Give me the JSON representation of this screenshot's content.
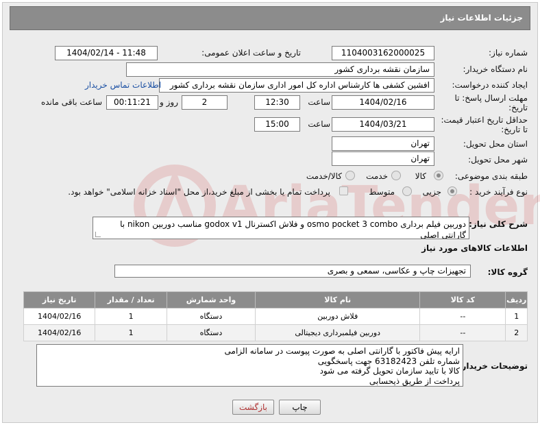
{
  "header": {
    "title": "جزئیات اطلاعات نیاز"
  },
  "watermark": {
    "text": "AriaTender.net"
  },
  "form": {
    "need_number": {
      "label": "شماره نیاز:",
      "value": "1104003162000025"
    },
    "announce_datetime": {
      "label": "تاریخ و ساعت اعلان عمومی:",
      "value": "1404/02/14 - 11:48"
    },
    "buyer_org": {
      "label": "نام دستگاه خریدار:",
      "value": "سازمان نقشه برداری کشور"
    },
    "requester": {
      "label": "ایجاد کننده درخواست:",
      "value": "افشین کشفی ها کارشناس اداره کل امور اداری سازمان نقشه برداری کشور",
      "contact_link": "اطلاعات تماس خریدار"
    },
    "reply_deadline": {
      "label_line1": "مهلت ارسال پاسخ: تا",
      "label_line2": "تاریخ:",
      "date": "1404/02/16",
      "time_label": "ساعت",
      "time": "12:30",
      "days": "2",
      "days_label": "روز و",
      "remaining": "00:11:21",
      "remaining_label": "ساعت باقی مانده"
    },
    "price_validity": {
      "label_line1": "حداقل تاریخ اعتبار قیمت:",
      "label_line2": "تا تاریخ:",
      "date": "1404/03/21",
      "time_label": "ساعت",
      "time": "15:00"
    },
    "delivery_province": {
      "label": "استان محل تحویل:",
      "value": "تهران"
    },
    "delivery_city": {
      "label": "شهر محل تحویل:",
      "value": "تهران"
    },
    "category": {
      "label": "طبقه بندی موضوعی:",
      "options": [
        "کالا",
        "خدمت",
        "کالا/خدمت"
      ],
      "selected": "کالا"
    },
    "process_type": {
      "label": "نوع فرآیند خرید :",
      "options": [
        "جزیی",
        "متوسط"
      ],
      "selected": "جزیی",
      "payment_note": "پرداخت تمام یا بخشی از مبلغ خرید،از محل \"اسناد خزانه اسلامی\" خواهد بود."
    },
    "general_desc": {
      "label": "شرح کلی نیاز:",
      "value": "دوربین فیلم برداری osmo pocket 3 combo و فلاش اکسترنال godox v1 مناسب دوربین nikon با گارانتی اصلی"
    },
    "goods_info_title": "اطلاعات کالاهای مورد نیاز",
    "goods_group": {
      "label": "گروه کالا:",
      "value": "تجهیزات چاپ و عکاسی، سمعی و بصری"
    }
  },
  "table": {
    "headers": [
      "ردیف",
      "کد کالا",
      "نام کالا",
      "واحد شمارش",
      "تعداد / مقدار",
      "تاریخ نیاز"
    ],
    "rows": [
      [
        "1",
        "--",
        "فلاش دوربین",
        "دستگاه",
        "1",
        "1404/02/16"
      ],
      [
        "2",
        "--",
        "دوربین فیلمبرداری دیجیتالی",
        "دستگاه",
        "1",
        "1404/02/16"
      ]
    ]
  },
  "buyer_notes": {
    "label": "توضیحات خریدار:",
    "lines": [
      "ارایه پیش فاکتور با گارانتی اصلی به صورت پیوست در سامانه الزامی",
      "شماره تلفن 63182423 جهت پاسخگویی",
      "کالا با تایید سازمان تحویل گرفته می شود",
      "پرداخت از طریق ذیحسابی"
    ]
  },
  "buttons": {
    "print": "چاپ",
    "back": "بازگشت"
  }
}
